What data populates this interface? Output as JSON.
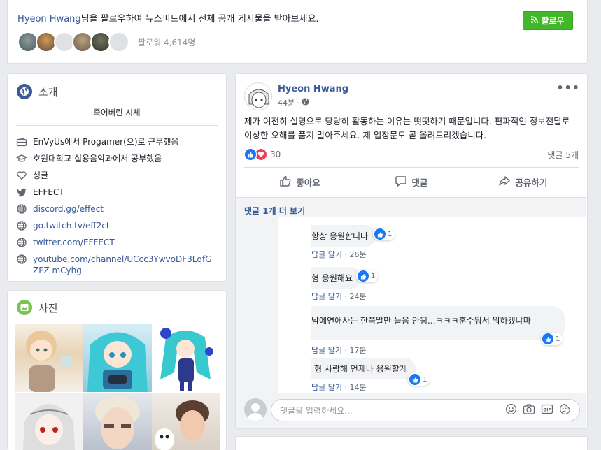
{
  "follow_banner": {
    "name": "Hyeon Hwang",
    "prompt_suffix": "님을 팔로우하여 뉴스피드에서 전체 공개 게시물을 받아보세요.",
    "follow_button": "팔로우",
    "followers": "팔로워 4,614명"
  },
  "intro": {
    "title": "소개",
    "bio": "죽어버린 시체",
    "items": [
      {
        "icon": "briefcase-icon",
        "text": "EnVyUs에서 Progamer(으)로 근무했음"
      },
      {
        "icon": "graduation-cap-icon",
        "text": "호원대학교 실용음악과에서 공부했음"
      },
      {
        "icon": "heart-icon",
        "text": "싱글"
      },
      {
        "icon": "twitter-icon",
        "text": "EFFECT"
      },
      {
        "icon": "globe-icon",
        "text": "discord.gg/effect"
      },
      {
        "icon": "globe-icon",
        "text": "go.twitch.tv/eff2ct"
      },
      {
        "icon": "globe-icon",
        "text": "twitter.com/EFFECT"
      },
      {
        "icon": "globe-icon",
        "text": "youtube.com/channel/UCcc3YwvoDF3LqfGZPZ mCyhg"
      }
    ]
  },
  "photos": {
    "title": "사진"
  },
  "post": {
    "author": "Hyeon Hwang",
    "time": "44분",
    "body": "제가 여전히 실명으로 당당히 활동하는 이유는 떳떳하기 때문입니다. 편파적인 정보전달로 이상한 오해를 품지 말아주세요. 제 입장문도 곧 올려드리겠습니다.",
    "reaction_count": "30",
    "comment_count": "댓글 5개",
    "actions": {
      "like": "좋아요",
      "comment": "댓글",
      "share": "공유하기"
    },
    "more_comments": "댓글 1개 더 보기",
    "comments": [
      {
        "text": "항상 응원합니다",
        "likes": "1",
        "reply": "답글 달기",
        "time": "26분"
      },
      {
        "text": "형 응원해요",
        "likes": "1",
        "reply": "답글 달기",
        "time": "24분"
      },
      {
        "text": "남에연애사는 한쪽말만 들음 안됨...ㅋㅋㅋ훈수둬서 뭐하겠냐마",
        "likes": "1",
        "reply": "답글 달기",
        "time": "17분"
      },
      {
        "text": "형 사랑해 언제나 응원할게",
        "likes": "1",
        "reply": "답글 달기",
        "time": "14분"
      }
    ],
    "comment_placeholder": "댓글을 입력하세요..."
  },
  "colors": {
    "brand_blue": "#385898",
    "follow_green": "#42b72a",
    "like_blue": "#1877f2",
    "love_red": "#f33e58"
  }
}
